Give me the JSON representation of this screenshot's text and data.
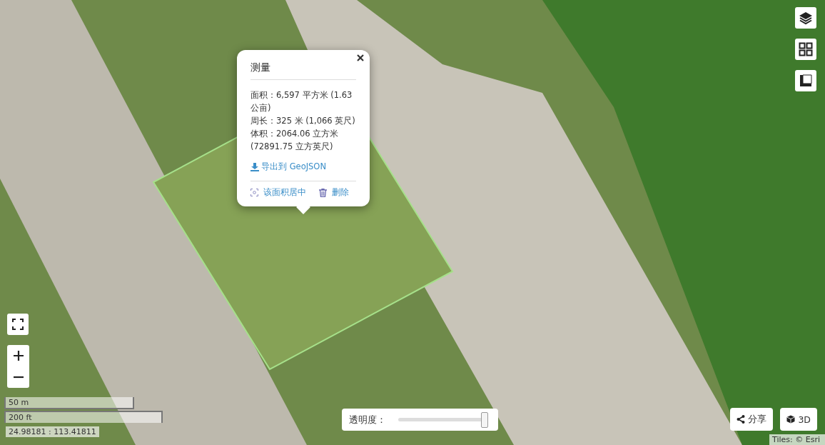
{
  "popup": {
    "title": "测量",
    "lines": [
      "面积：6,597 平方米 (1.63 公亩)",
      "周长：325 米 (1,066 英尺)",
      "体积：2064.06 立方米 (72891.75 立方英尺)"
    ],
    "export_link": "导出到 GeoJSON",
    "actions": [
      {
        "kind": "center",
        "label": "该面积居中"
      },
      {
        "kind": "delete",
        "label": "删除"
      }
    ]
  },
  "scale": {
    "metric": "50 m",
    "imperial": "200 ft"
  },
  "coordinates": "24.98181 : 113.41811",
  "opacity": {
    "label": "透明度：",
    "level": 0.97
  },
  "buttons": [
    {
      "kind": "share",
      "label": "分享"
    },
    {
      "kind": "cube",
      "label": "3D"
    }
  ],
  "attribution": "Tiles: © Esri"
}
